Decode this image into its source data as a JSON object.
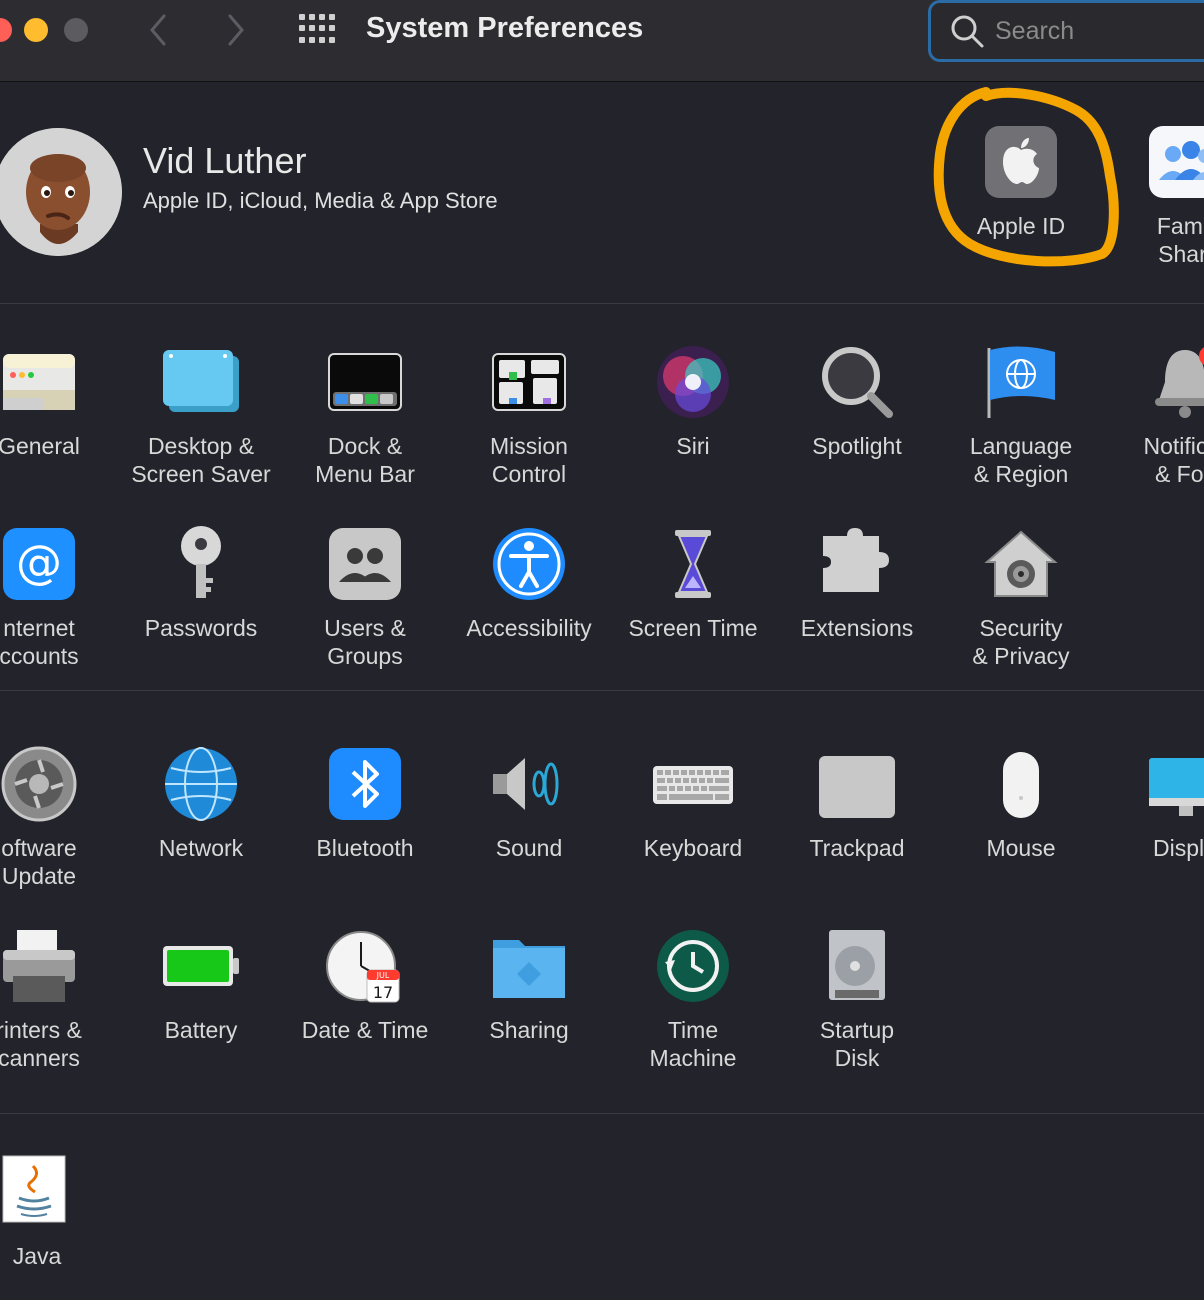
{
  "window": {
    "title": "System Preferences",
    "search_placeholder": "Search",
    "colors": {
      "close": "#ff5f57",
      "minimize": "#febc2e",
      "zoom_inactive": "#5b5b60",
      "search_focus_ring": "#2c6ca6"
    }
  },
  "account": {
    "name": "Vid Luther",
    "subtitle": "Apple ID, iCloud, Media & App Store",
    "panes": [
      {
        "label": "Apple ID",
        "icon": "apple-logo-icon"
      },
      {
        "label": "Famil\nShari",
        "icon": "family-sharing-icon"
      }
    ],
    "annotation_color": "#f5a500"
  },
  "sections": [
    [
      {
        "label": "General",
        "icon": "general-icon"
      },
      {
        "label": "Desktop &\nScreen Saver",
        "icon": "desktop-icon"
      },
      {
        "label": "Dock &\nMenu Bar",
        "icon": "dock-icon"
      },
      {
        "label": "Mission\nControl",
        "icon": "mission-control-icon"
      },
      {
        "label": "Siri",
        "icon": "siri-icon"
      },
      {
        "label": "Spotlight",
        "icon": "spotlight-icon"
      },
      {
        "label": "Language\n& Region",
        "icon": "language-flag-icon"
      },
      {
        "label": "Notificat\n& Foc",
        "icon": "notifications-bell-icon"
      },
      {
        "label": "nternet\nccounts",
        "icon": "at-sign-icon"
      },
      {
        "label": "Passwords",
        "icon": "key-icon"
      },
      {
        "label": "Users &\nGroups",
        "icon": "users-icon"
      },
      {
        "label": "Accessibility",
        "icon": "accessibility-icon"
      },
      {
        "label": "Screen Time",
        "icon": "hourglass-icon"
      },
      {
        "label": "Extensions",
        "icon": "puzzle-icon"
      },
      {
        "label": "Security\n& Privacy",
        "icon": "security-house-icon"
      }
    ],
    [
      {
        "label": "oftware\nUpdate",
        "icon": "gear-icon"
      },
      {
        "label": "Network",
        "icon": "globe-icon"
      },
      {
        "label": "Bluetooth",
        "icon": "bluetooth-icon"
      },
      {
        "label": "Sound",
        "icon": "speaker-icon"
      },
      {
        "label": "Keyboard",
        "icon": "keyboard-icon"
      },
      {
        "label": "Trackpad",
        "icon": "trackpad-icon"
      },
      {
        "label": "Mouse",
        "icon": "mouse-icon"
      },
      {
        "label": "Displa",
        "icon": "display-icon"
      },
      {
        "label": "rinters &\ncanners",
        "icon": "printer-icon"
      },
      {
        "label": "Battery",
        "icon": "battery-icon"
      },
      {
        "label": "Date & Time",
        "icon": "clock-icon",
        "calendar_month": "JUL",
        "calendar_day": "17"
      },
      {
        "label": "Sharing",
        "icon": "sharing-folder-icon"
      },
      {
        "label": "Time\nMachine",
        "icon": "time-machine-icon"
      },
      {
        "label": "Startup\nDisk",
        "icon": "hard-disk-icon"
      }
    ],
    [
      {
        "label": "Java",
        "icon": "java-icon"
      }
    ]
  ]
}
